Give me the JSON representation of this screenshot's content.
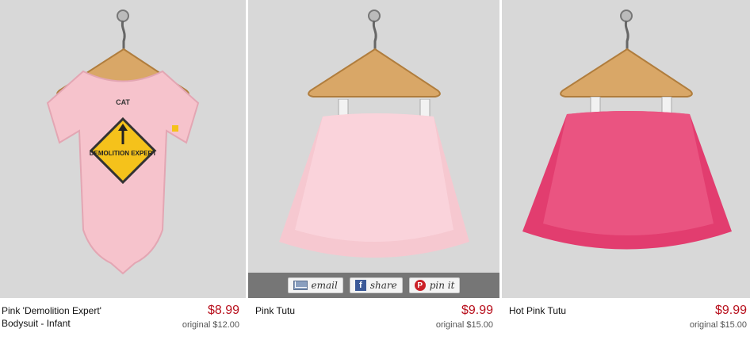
{
  "products": [
    {
      "title_line1": "Pink 'Demolition Expert'",
      "title_line2": "Bodysuit - Infant",
      "price": "$8.99",
      "original": "original $12.00",
      "sign_text": "DEMOLITION EXPERT",
      "brand": "CAT",
      "garment_color": "#f6c3cc"
    },
    {
      "title_line1": "Pink Tutu",
      "title_line2": "",
      "price": "$9.99",
      "original": "original $15.00",
      "garment_color": "#f9c6cf"
    },
    {
      "title_line1": "Hot Pink Tutu",
      "title_line2": "",
      "price": "$9.99",
      "original": "original $15.00",
      "garment_color": "#e23d6f"
    }
  ],
  "share": {
    "email": "email",
    "share": "share",
    "pin": "pin it"
  },
  "colors": {
    "price": "#b8101d",
    "photo_bg": "#d8d8d8"
  }
}
